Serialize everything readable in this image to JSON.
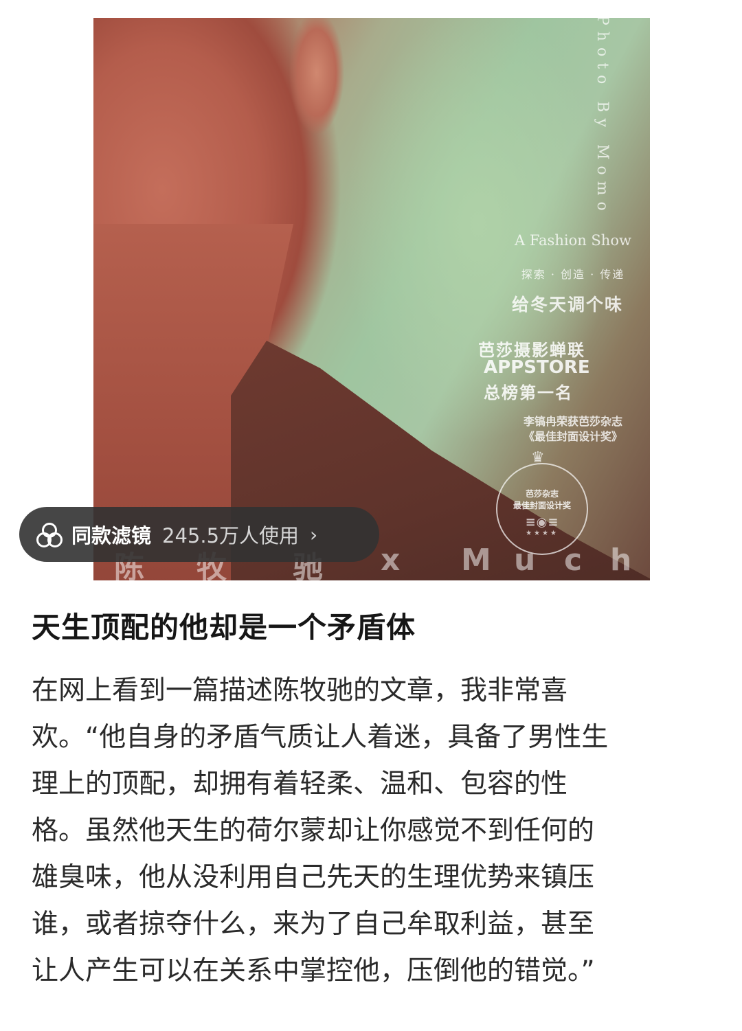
{
  "photo": {
    "vertical_credit": "Photo By Momo",
    "fashion_show": "A Fashion Show",
    "slogan": "探索 · 创造 · 传递",
    "tagline": "给冬天调个味",
    "rank_line1": "芭莎摄影蝉联",
    "rank_line2": "APPSTORE",
    "rank_line3": "总榜第一名",
    "award_line1": "李镐冉荣获芭莎杂志",
    "award_line2": "《最佳封面设计奖》",
    "seal_line1": "芭莎杂志",
    "seal_line2": "最佳封面设计奖",
    "bottom_chars": [
      "陈",
      "牧",
      "驰",
      "x",
      "M",
      "u",
      "c",
      "h"
    ]
  },
  "filter_pill": {
    "icon": "filter-circles-icon",
    "label": "同款滤镜",
    "usage": "245.5万人使用",
    "chevron": "›"
  },
  "article": {
    "title": "天生顶配的他却是一个矛盾体",
    "lines": [
      "在网上看到一篇描述陈牧驰的文章，我非常喜",
      "欢。“他自身的矛盾气质让人着迷，具备了男性生",
      "理上的顶配，却拥有着轻柔、温和、包容的性",
      "格。虽然他天生的荷尔蒙却让你感觉不到任何的",
      "雄臭味，他从没利用自己先天的生理优势来镇压",
      "谁，或者掠夺什么，来为了自己牟取利益，甚至",
      "让人产生可以在关系中掌控他，压倒他的错觉。”"
    ]
  }
}
